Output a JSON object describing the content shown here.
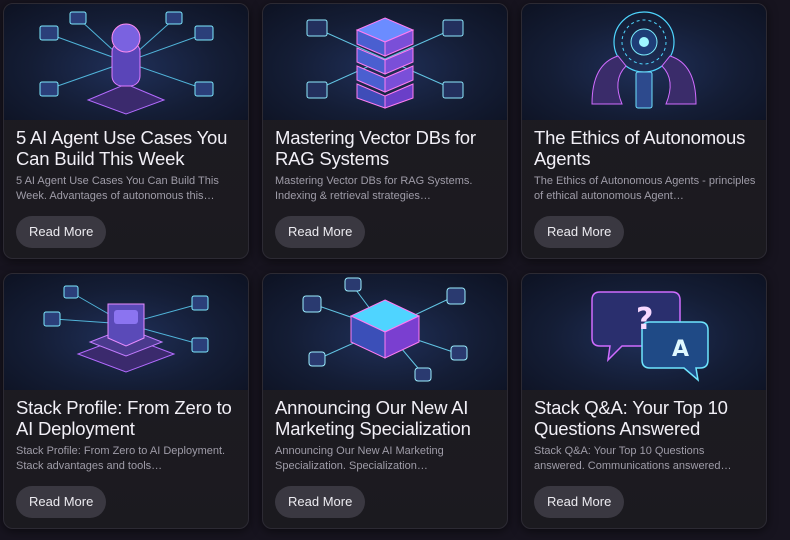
{
  "articles": [
    {
      "title": "5 AI Agent Use Cases You Can Build This Week",
      "excerpt": "5 AI Agent Use Cases You Can Build This Week. Advantages of autonomous this…",
      "button": "Read More",
      "image_icon": "ai-agent-network-icon"
    },
    {
      "title": "Mastering Vector DBs for RAG Systems",
      "excerpt": "Mastering Vector DBs for RAG Systems. Indexing & retrieval strategies…",
      "button": "Read More",
      "image_icon": "vector-database-icon"
    },
    {
      "title": "The Ethics of Autonomous Agents",
      "excerpt": "The Ethics of Autonomous Agents - principles of ethical autonomous Agent…",
      "button": "Read More",
      "image_icon": "hands-ethics-icon"
    },
    {
      "title": "Stack Profile: From Zero to AI Deployment",
      "excerpt": "Stack Profile: From Zero to AI Deployment. Stack advantages and tools…",
      "button": "Read More",
      "image_icon": "stack-deployment-icon"
    },
    {
      "title": "Announcing Our New AI Marketing Specialization",
      "excerpt": "Announcing Our New AI Marketing Specialization. Specialization…",
      "button": "Read More",
      "image_icon": "marketing-network-icon"
    },
    {
      "title": "Stack Q&A: Your Top 10 Questions Answered",
      "excerpt": "Stack Q&A: Your Top 10 Questions answered. Communications answered…",
      "button": "Read More",
      "image_icon": "qa-speech-bubble-icon"
    }
  ],
  "colors": {
    "background": "#17141f",
    "card": "#1d1b22",
    "button": "#3a3841",
    "accent_cyan": "#5fe3ff",
    "accent_magenta": "#d65cff"
  }
}
